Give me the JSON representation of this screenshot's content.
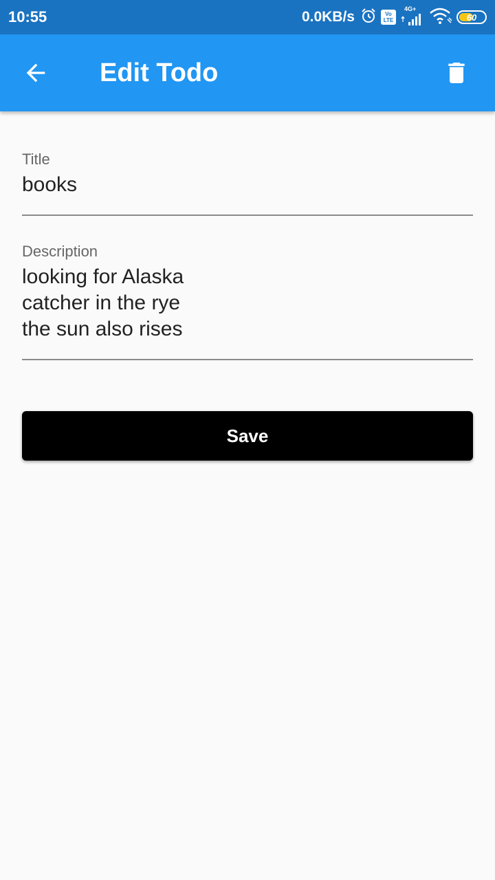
{
  "status_bar": {
    "time": "10:55",
    "net_speed": "0.0KB/s",
    "volte_top": "Vo",
    "volte_bottom": "LTE",
    "network_type": "4G+",
    "battery_level": "60",
    "battery_fraction": 0.6,
    "icons": [
      "alarm-icon",
      "volte-icon",
      "signal-icon",
      "wifi-icon",
      "battery-icon"
    ],
    "background_color": "#1a73c1"
  },
  "app_bar": {
    "title": "Edit Todo",
    "background_color": "#2196f3",
    "back_icon": "arrow-back-icon",
    "delete_icon": "trash-icon"
  },
  "form": {
    "title_field": {
      "label": "Title",
      "value": "books"
    },
    "description_field": {
      "label": "Description",
      "value": "looking for Alaska\ncatcher in the rye\nthe sun also rises"
    }
  },
  "save_button": {
    "label": "Save",
    "background_color": "#000000"
  }
}
